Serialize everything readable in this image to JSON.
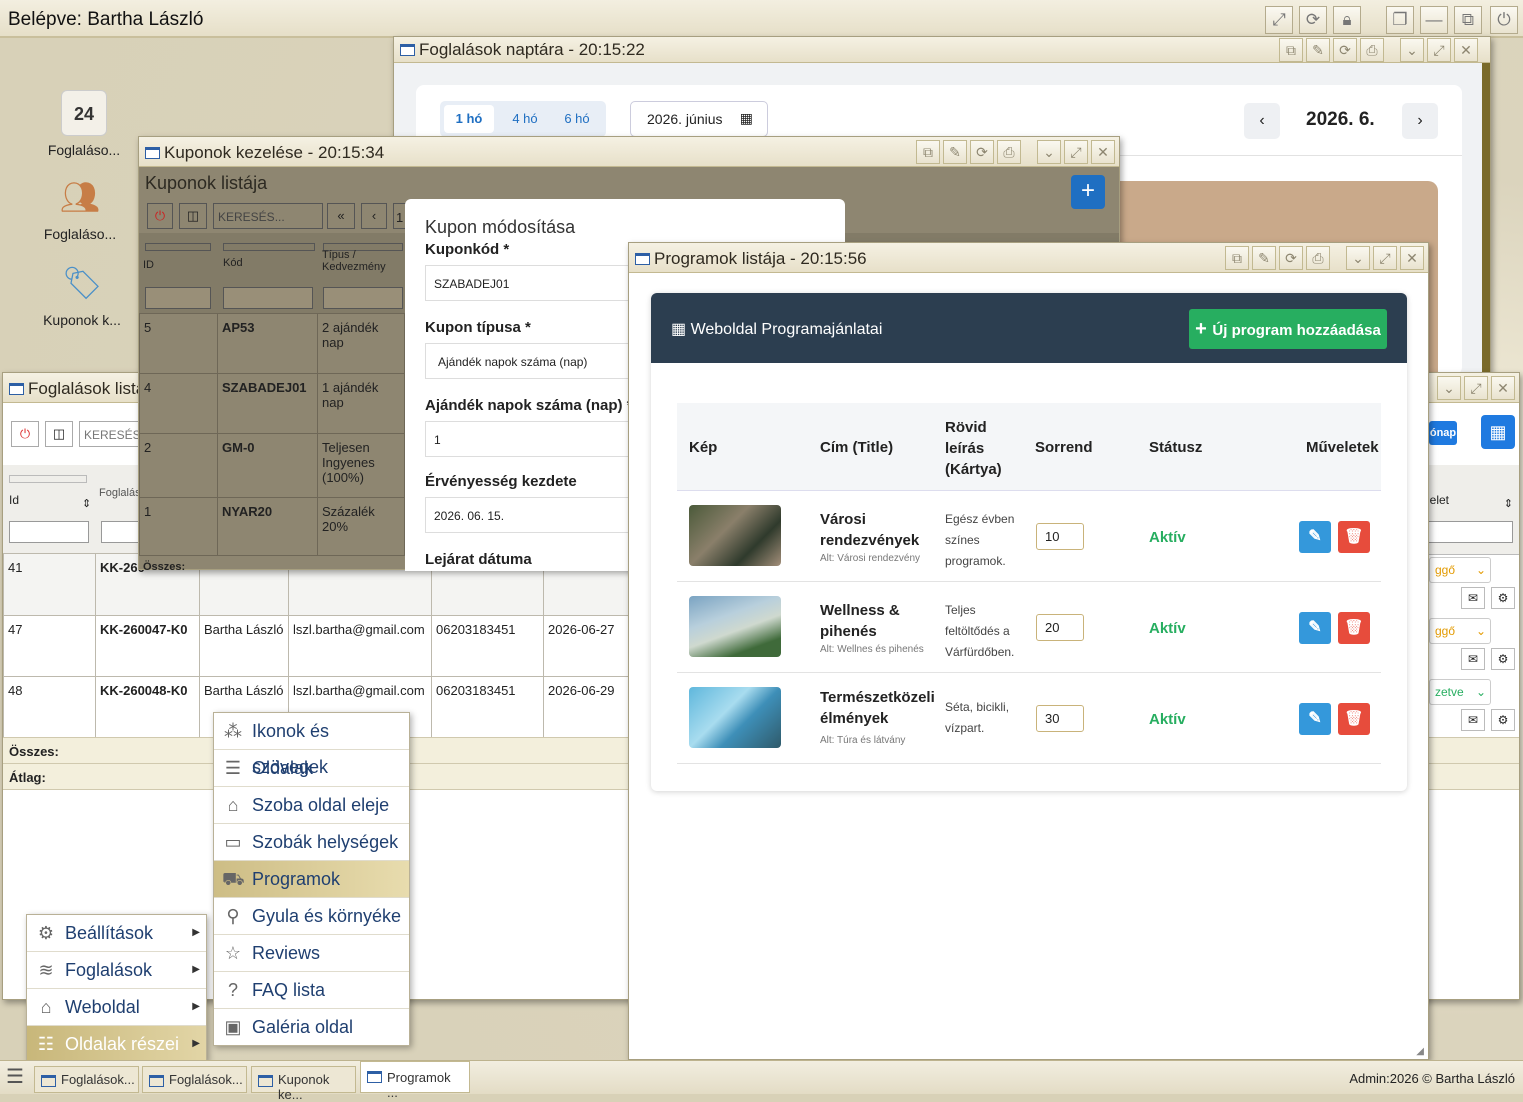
{
  "topbar": {
    "user": "Belépve: Bartha László"
  },
  "desktop_icons": [
    {
      "label": "Foglaláso..."
    },
    {
      "label": "Foglaláso..."
    },
    {
      "label": "Kuponok k..."
    }
  ],
  "calendar_win": {
    "title": "Foglalások naptára - 20:15:22",
    "tabs": [
      "1 hó",
      "4 hó",
      "6 hó"
    ],
    "date_picker": "2026. június",
    "month": "2026. 6.",
    "prev": "‹",
    "next": "›"
  },
  "bookings_win": {
    "title": "Foglalások listá",
    "search_placeholder": "KERESÉS...",
    "col_id": "Id",
    "col_booking": "Foglalás",
    "col_right": "elet",
    "chip": "ónap",
    "rows": [
      {
        "id": "41",
        "code": "KK-260",
        "name": "",
        "email": "",
        "phone": "",
        "date": "",
        "status": "ggő"
      },
      {
        "id": "47",
        "code": "KK-260047-K0",
        "name": "Bartha László",
        "email": "lszl.bartha@gmail.com",
        "phone": "06203183451",
        "date": "2026-06-27",
        "status": "ggő"
      },
      {
        "id": "48",
        "code": "KK-260048-K0",
        "name": "Bartha László",
        "email": "lszl.bartha@gmail.com",
        "phone": "06203183451",
        "date": "2026-06-29",
        "status": "zetve"
      }
    ],
    "sum": "Összes:",
    "avg": "Átlag:"
  },
  "coupons_win": {
    "title": "Kuponok kezelése - 20:15:34",
    "list_title": "Kuponok listája",
    "search_placeholder": "KERESÉS...",
    "col_id": "ID",
    "col_code": "Kód",
    "col_type": "Típus / Kedvezmény",
    "page_prefix": "1",
    "sum": "Összes:",
    "rows": [
      {
        "id": "5",
        "code": "AP53",
        "type": "2 ajándék nap"
      },
      {
        "id": "4",
        "code": "SZABADEJ01",
        "type": "1 ajándék nap"
      },
      {
        "id": "2",
        "code": "GM-0",
        "type": "Teljesen Ingyenes (100%)"
      },
      {
        "id": "1",
        "code": "NYAR20",
        "type": "Százalék 20%"
      }
    ]
  },
  "coupon_form": {
    "title": "Kupon módosítása",
    "code_label": "Kuponkód *",
    "code_value": "SZABADEJ01",
    "type_label": "Kupon típusa *",
    "type_value": "Ajándék napok száma (nap)",
    "days_label": "Ajándék napok száma (nap) *",
    "days_value": "1",
    "start_label": "Érvényesség kezdete",
    "start_value": "2026. 06. 15.",
    "end_label": "Lejárat dátuma"
  },
  "programs_win": {
    "title": "Programok listája - 20:15:56",
    "panel_title": "Weboldal Programajánlatai",
    "add_button": "Új program hozzáadása",
    "headers": {
      "image": "Kép",
      "title": "Cím (Title)",
      "desc": "Rövid leírás (Kártya)",
      "order": "Sorrend",
      "status": "Státusz",
      "actions": "Műveletek"
    },
    "rows": [
      {
        "title": "Városi rendezvények",
        "alt": "Alt: Városi rendezvény",
        "desc": "Egész évben színes programok.",
        "order": "10",
        "status": "Aktív"
      },
      {
        "title": "Wellness & pihenés",
        "alt": "Alt: Wellnes és pihenés",
        "desc": "Teljes feltöltődés a Várfürdőben.",
        "order": "20",
        "status": "Aktív"
      },
      {
        "title": "Természetközeli élmények",
        "alt": "Alt: Túra és látvány",
        "desc": "Séta, bicikli, vízpart.",
        "order": "30",
        "status": "Aktív"
      }
    ]
  },
  "main_menu": [
    {
      "label": "Beállítások",
      "icon": "gear-icon"
    },
    {
      "label": "Foglalások",
      "icon": "booking-icon"
    },
    {
      "label": "Weboldal",
      "icon": "home-icon"
    },
    {
      "label": "Oldalak részei",
      "icon": "parts-icon"
    }
  ],
  "sub_menu": [
    {
      "label": "Ikonok és szövegek",
      "icon": "icons-icon"
    },
    {
      "label": "Oldalak",
      "icon": "lines-icon"
    },
    {
      "label": "Szoba oldal eleje",
      "icon": "room-icon"
    },
    {
      "label": "Szobák helységek",
      "icon": "sofa-icon"
    },
    {
      "label": "Programok",
      "icon": "program-icon"
    },
    {
      "label": "Gyula és környéke",
      "icon": "route-icon"
    },
    {
      "label": "Reviews",
      "icon": "star-icon"
    },
    {
      "label": "FAQ lista",
      "icon": "question-icon"
    },
    {
      "label": "Galéria oldal",
      "icon": "image-icon"
    }
  ],
  "taskbar": {
    "tasks": [
      "Foglalások...",
      "Foglalások...",
      "Kuponok ke...",
      "Programok ..."
    ],
    "footer": "Admin:2026 © Bartha László"
  },
  "colors": {
    "accent_green": "#27ae60",
    "header_dark": "#2c3e50",
    "edit_blue": "#3498db",
    "delete_red": "#e74c3c",
    "gold": "#c8b77a"
  }
}
